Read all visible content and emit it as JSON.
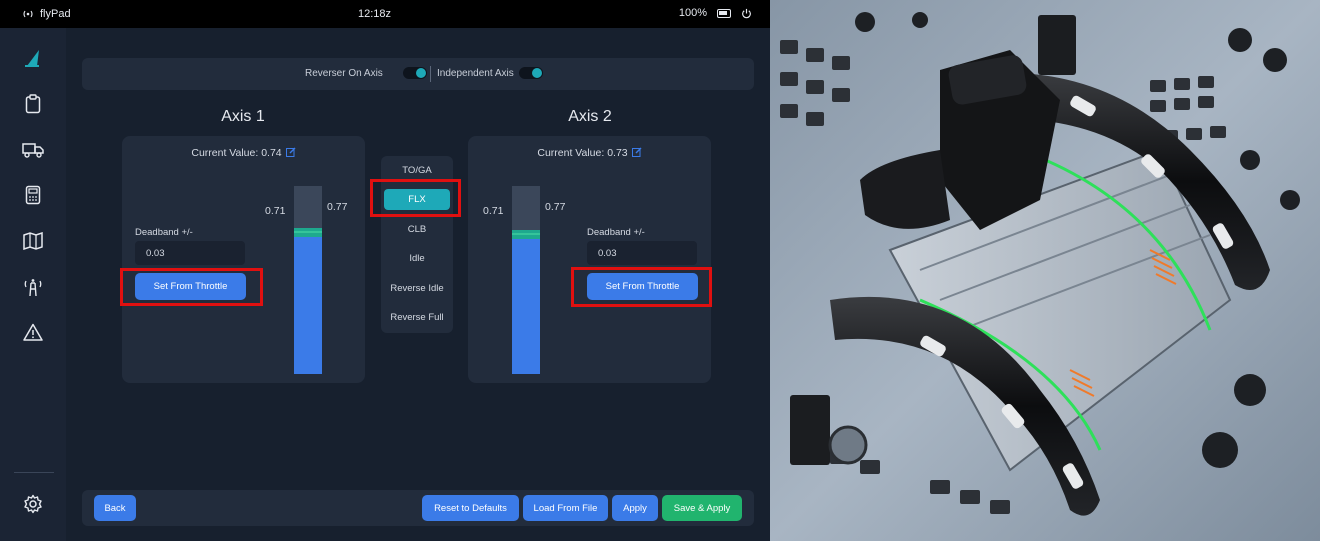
{
  "status_bar": {
    "app_name": "flyPad",
    "time": "12:18z",
    "battery": "100%"
  },
  "sidebar": {
    "items": [
      "logo",
      "checklist-icon",
      "truck-icon",
      "calculator-icon",
      "map-icon",
      "tower-icon",
      "warning-icon",
      "settings-icon"
    ]
  },
  "toggles": {
    "reverser_label": "Reverser On Axis",
    "independent_label": "Independent Axis"
  },
  "axis1": {
    "title": "Axis 1",
    "current_value": "Current Value: 0.74",
    "deadband_label": "Deadband +/-",
    "deadband_value": "0.03",
    "set_button": "Set From Throttle",
    "lower_label": "0.71",
    "upper_label": "0.77",
    "bar_level": 0.74
  },
  "axis2": {
    "title": "Axis 2",
    "current_value": "Current Value: 0.73",
    "deadband_label": "Deadband +/-",
    "deadband_value": "0.03",
    "set_button": "Set From Throttle",
    "lower_label": "0.71",
    "upper_label": "0.77",
    "bar_level": 0.73
  },
  "detents": {
    "items": [
      "TO/GA",
      "FLX",
      "CLB",
      "Idle",
      "Reverse Idle",
      "Reverse Full"
    ],
    "selected": "FLX"
  },
  "footer": {
    "back": "Back",
    "reset": "Reset to Defaults",
    "load": "Load From File",
    "apply": "Apply",
    "save_apply": "Save & Apply"
  },
  "colors": {
    "accent_teal": "#1ea9b8",
    "button_blue": "#3b7be8",
    "save_green": "#21b46e",
    "highlight_red": "#e01010"
  }
}
